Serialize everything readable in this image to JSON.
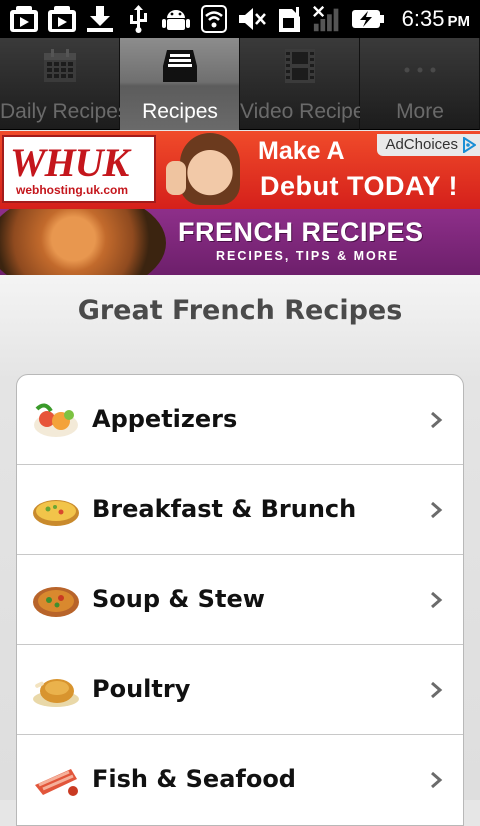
{
  "status_bar": {
    "time": "6:35",
    "ampm": "PM",
    "icons": [
      "photo-icon",
      "play-icon",
      "download-icon",
      "usb-icon",
      "android-icon",
      "wifi-icon",
      "mute-icon",
      "sim-icon",
      "signal-icon",
      "battery-icon"
    ]
  },
  "tabs": [
    {
      "label": "Daily Recipes",
      "icon": "calendar-icon",
      "active": false
    },
    {
      "label": "Recipes",
      "icon": "inbox-icon",
      "active": true
    },
    {
      "label": "Video Recipe",
      "icon": "film-icon",
      "active": false
    },
    {
      "label": "More",
      "icon": "more-icon",
      "active": false
    }
  ],
  "ad": {
    "logo": "WHUK",
    "logo_sub": "webhosting.uk.com",
    "line1": "Make A",
    "line2": "Debut TODAY !",
    "choices": "AdChoices"
  },
  "banner": {
    "title": "FRENCH RECIPES",
    "subtitle": "RECIPES, TIPS & MORE"
  },
  "page_title": "Great French Recipes",
  "categories": [
    {
      "label": "Appetizers",
      "icon": "appetizers-icon"
    },
    {
      "label": "Breakfast & Brunch",
      "icon": "breakfast-icon"
    },
    {
      "label": "Soup & Stew",
      "icon": "soup-icon"
    },
    {
      "label": "Poultry",
      "icon": "poultry-icon"
    },
    {
      "label": "Fish & Seafood",
      "icon": "fish-icon"
    }
  ],
  "colors": {
    "tab_active": "#6f6f6f",
    "ad_red": "#d5201b",
    "banner_purple": "#7a2677",
    "title_text": "#4a4a4a"
  }
}
